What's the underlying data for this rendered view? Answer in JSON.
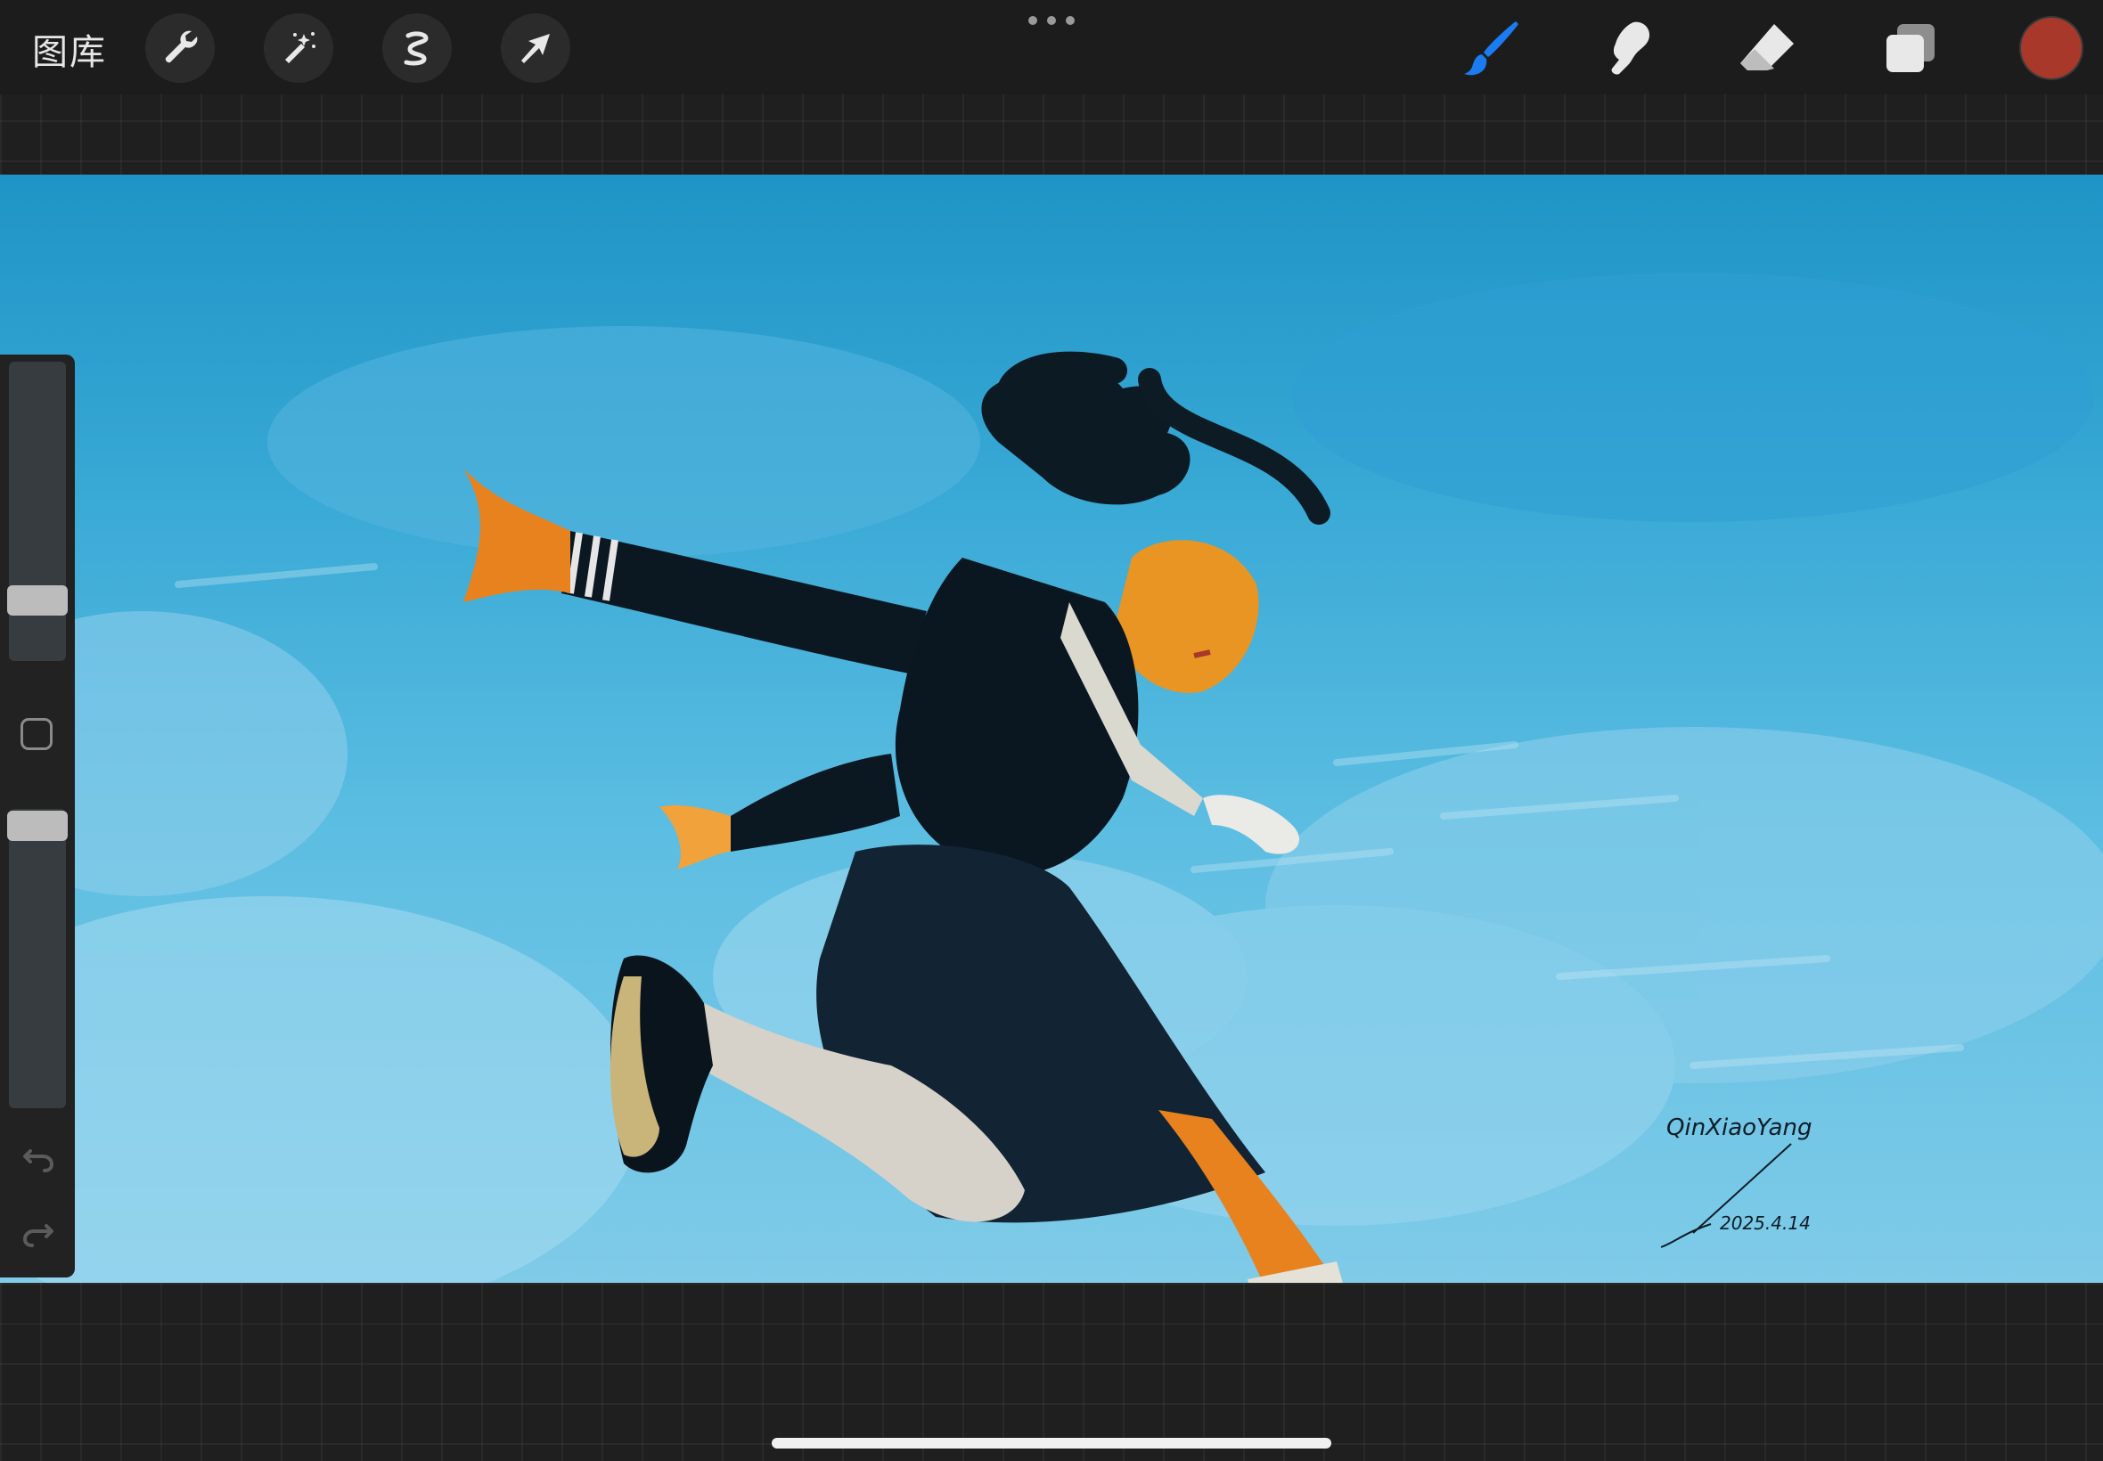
{
  "topbar": {
    "gallery_label": "图库",
    "left_tools": [
      {
        "icon": "wrench-icon"
      },
      {
        "icon": "magic-wand-icon"
      },
      {
        "icon": "selection-icon"
      },
      {
        "icon": "transform-arrow-icon"
      }
    ],
    "more_icon": "more-dots-icon",
    "right_tools": [
      {
        "icon": "brush-icon",
        "active": true
      },
      {
        "icon": "smudge-icon",
        "active": false
      },
      {
        "icon": "eraser-icon",
        "active": false
      },
      {
        "icon": "layers-icon",
        "active": false
      }
    ],
    "current_color": "#a8392a"
  },
  "canvas": {
    "signature_name": "QinXiaoYang",
    "signature_date": "2025.4.14",
    "sky_colors": [
      "#1e94c6",
      "#7fcbe8"
    ]
  },
  "sidebar": {
    "brush_size_level": 0.22,
    "opacity_level": 0.96,
    "undo_icon": "undo-icon",
    "redo_icon": "redo-icon",
    "modify_icon": "modify-square-icon"
  },
  "colors": {
    "accent_blue": "#1a7cf0",
    "toolbar_bg": "#1c1c1c",
    "icon_white": "#e8e8e8"
  }
}
